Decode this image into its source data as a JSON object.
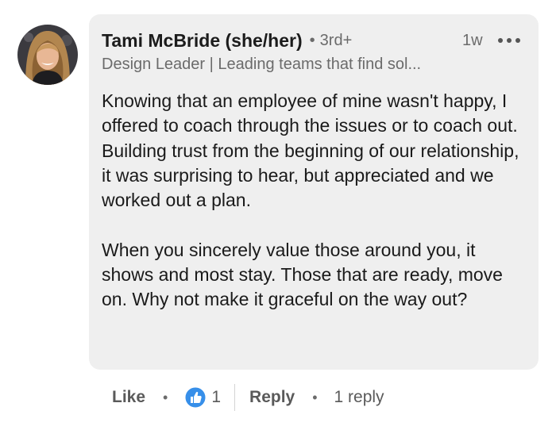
{
  "comment": {
    "author_name": "Tami McBride (she/her)",
    "separator": "•",
    "connection_degree": "3rd+",
    "time_ago": "1w",
    "headline": "Design Leader | Leading teams that find sol...",
    "body_paragraphs": [
      "Knowing that an employee of mine wasn't happy, I offered to coach through the issues or to coach out. Building trust from the beginning of our relationship, it was surprising to hear, but appreciated and we worked out a plan.",
      "When you sincerely value those around you, it shows and most stay. Those that are ready, move on. Why not make it graceful on the way out?"
    ],
    "avatar_icon": "profile-photo",
    "more_icon": "more-horizontal-icon"
  },
  "actions": {
    "like_label": "Like",
    "dot": "•",
    "reaction_icon": "like-reaction-icon",
    "reaction_count": "1",
    "reply_label": "Reply",
    "reply_count_label": "1 reply"
  },
  "colors": {
    "bubble_background": "#efefef",
    "secondary_text": "#6b6b6b",
    "like_blue": "#378fe9"
  }
}
